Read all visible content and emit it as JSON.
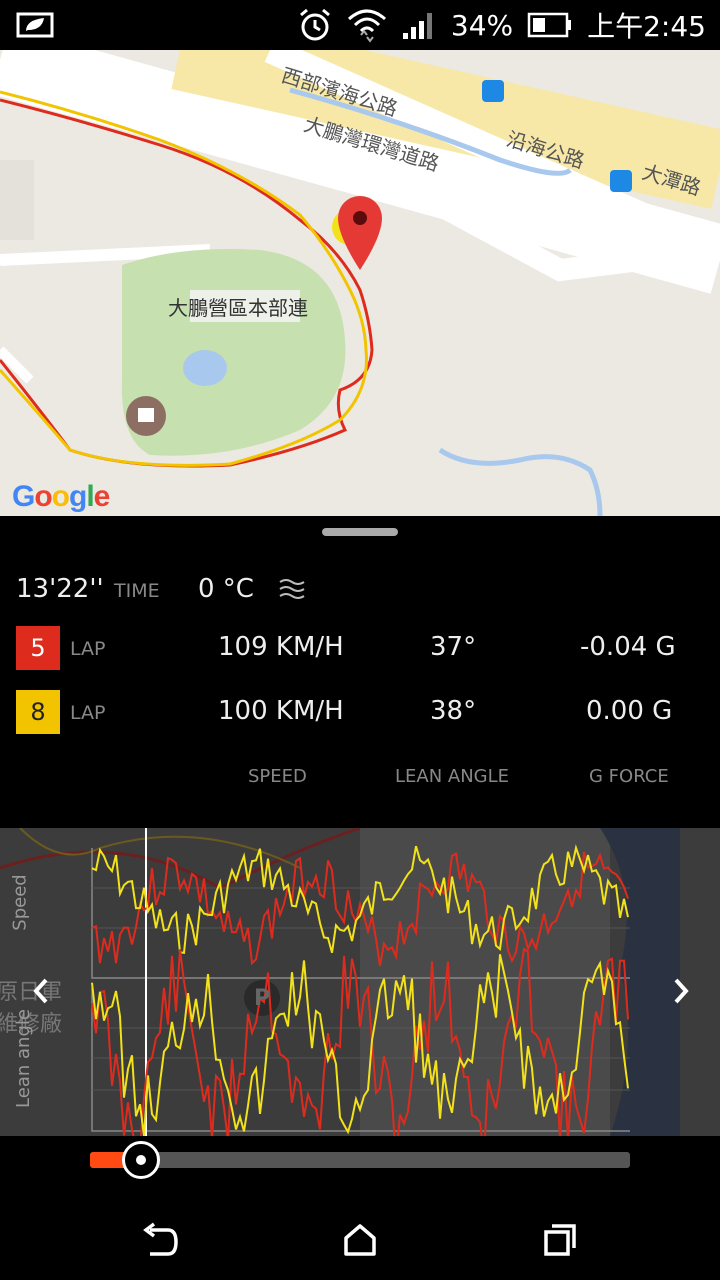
{
  "status_bar": {
    "battery": "34%",
    "time": "上午2:45"
  },
  "map": {
    "roads": [
      "西部濱海公路",
      "大鵬灣環灣道路",
      "沿海公路",
      "大潭路"
    ],
    "poi": "大鵬營區本部連",
    "google": [
      "G",
      "o",
      "o",
      "g",
      "l",
      "e"
    ]
  },
  "stats": {
    "time_value": "13'22''",
    "time_label": "TIME",
    "temperature": "0 °C",
    "laps": [
      {
        "lap": "5",
        "label": "LAP",
        "speed": "109 KM/H",
        "lean": "37°",
        "gforce": "-0.04 G",
        "color": "#dd2c1e"
      },
      {
        "lap": "8",
        "label": "LAP",
        "speed": "100 KM/H",
        "lean": "38°",
        "gforce": "0.00 G",
        "color": "#f2c400"
      }
    ],
    "columns": {
      "speed": "SPEED",
      "lean": "LEAN ANGLE",
      "gforce": "G FORCE"
    }
  },
  "chart": {
    "speed_label": "Speed",
    "lean_label": "Lean angle",
    "bg_labels": [
      "原日軍",
      "維修廠"
    ],
    "parking": "P"
  },
  "scrubber": {
    "progress": 0.09
  },
  "colors": {
    "red": "#dd2c1e",
    "yellow": "#f2e21a",
    "scrub": "#ff4a14"
  }
}
